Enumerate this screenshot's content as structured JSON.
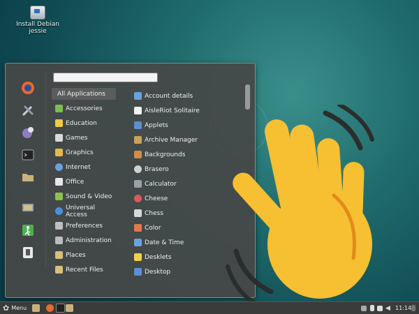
{
  "desktop": {
    "icon_label": "Install Debian jessie"
  },
  "menu": {
    "search_value": "",
    "favorites": [
      "firefox-icon",
      "settings-icon",
      "chat-icon",
      "terminal-icon",
      "folder-icon",
      "display-icon",
      "exit-icon",
      "device-icon"
    ],
    "categories": [
      {
        "label": "All Applications",
        "icon": "none",
        "color": "#000000"
      },
      {
        "label": "Accessories",
        "icon": "accessories-icon",
        "color": "#7bbf4d"
      },
      {
        "label": "Education",
        "icon": "education-icon",
        "color": "#f0c94b"
      },
      {
        "label": "Games",
        "icon": "games-icon",
        "color": "#d9d9d9"
      },
      {
        "label": "Graphics",
        "icon": "graphics-icon",
        "color": "#e6b94d"
      },
      {
        "label": "Internet",
        "icon": "internet-icon",
        "color": "#6aa2dc"
      },
      {
        "label": "Office",
        "icon": "office-icon",
        "color": "#e8e8e8"
      },
      {
        "label": "Sound & Video",
        "icon": "media-icon",
        "color": "#8bc34a"
      },
      {
        "label": "Universal Access",
        "icon": "access-icon",
        "color": "#4a90d9"
      },
      {
        "label": "Preferences",
        "icon": "preferences-icon",
        "color": "#c0c0c0"
      },
      {
        "label": "Administration",
        "icon": "admin-icon",
        "color": "#bdbdbd"
      },
      {
        "label": "Places",
        "icon": "places-icon",
        "color": "#d8c07a"
      },
      {
        "label": "Recent Files",
        "icon": "recent-icon",
        "color": "#d8c07a"
      }
    ],
    "apps": [
      {
        "label": "Account details",
        "color": "#6aa2dc"
      },
      {
        "label": "AisleRiot Solitaire",
        "color": "#f2f2f2"
      },
      {
        "label": "Applets",
        "color": "#5b8fd1"
      },
      {
        "label": "Archive Manager",
        "color": "#c9a35a"
      },
      {
        "label": "Backgrounds",
        "color": "#d18b4a"
      },
      {
        "label": "Brasero",
        "color": "#d0d0d0"
      },
      {
        "label": "Calculator",
        "color": "#9aa0a6"
      },
      {
        "label": "Cheese",
        "color": "#d95b5b"
      },
      {
        "label": "Chess",
        "color": "#d9d9d9"
      },
      {
        "label": "Color",
        "color": "#e07a4a"
      },
      {
        "label": "Date & Time",
        "color": "#6aa2dc"
      },
      {
        "label": "Desklets",
        "color": "#f0d04b"
      },
      {
        "label": "Desktop",
        "color": "#5b8fd1"
      }
    ]
  },
  "taskbar": {
    "menu_label": "Menu",
    "time": "11:14"
  }
}
